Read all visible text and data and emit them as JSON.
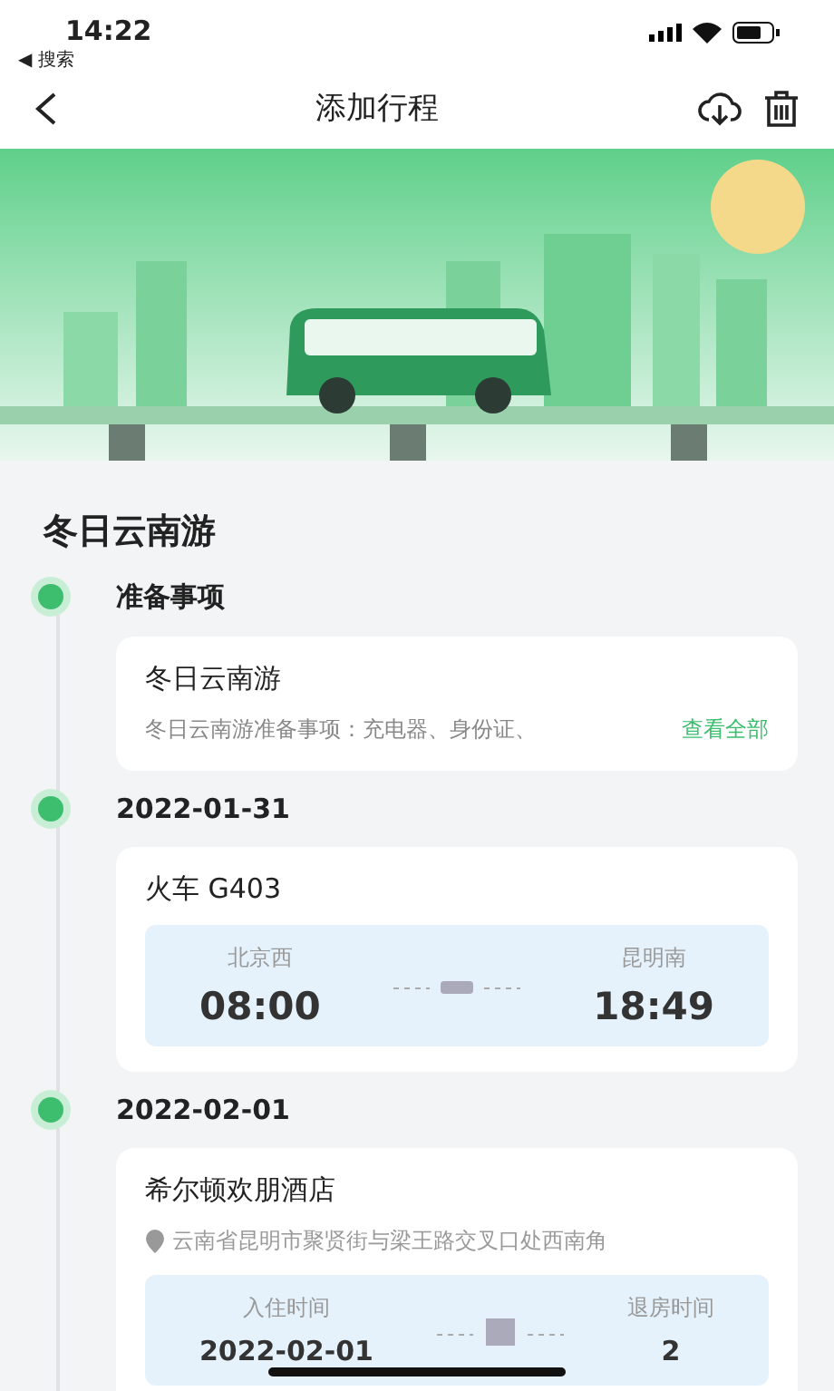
{
  "status_bar": {
    "time": "14:22",
    "back_app": "◀ 搜索"
  },
  "nav": {
    "title": "添加行程"
  },
  "trip": {
    "title": "冬日云南游"
  },
  "timeline": [
    {
      "kind": "note",
      "heading": "准备事项",
      "card": {
        "title": "冬日云南游",
        "text": "冬日云南游准备事项：充电器、身份证、",
        "link": "查看全部"
      }
    },
    {
      "kind": "train",
      "heading": "2022-01-31",
      "card": {
        "title": "火车 G403",
        "from": "北京西",
        "depart": "08:00",
        "to": "昆明南",
        "arrive": "18:49"
      }
    },
    {
      "kind": "hotel",
      "heading": "2022-02-01",
      "card": {
        "title": "希尔顿欢朋酒店",
        "address": "云南省昆明市聚贤街与梁王路交叉口处西南角",
        "from": "入住时间",
        "depart": "2022-02-01",
        "to": "退房时间",
        "arrive": "2"
      }
    }
  ]
}
